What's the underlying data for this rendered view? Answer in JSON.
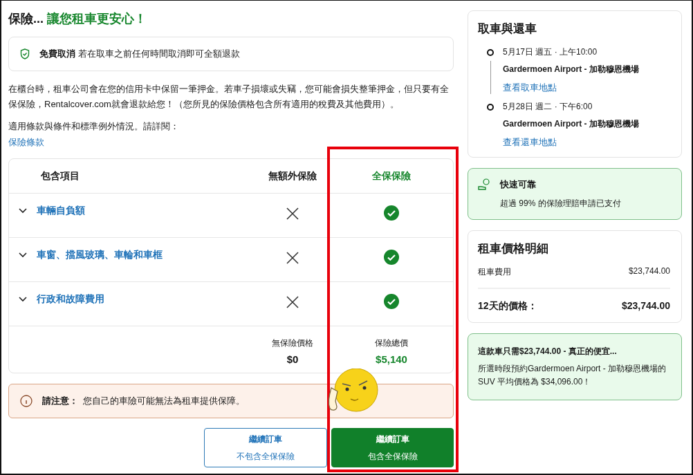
{
  "heading": {
    "prefix": "保險...",
    "highlight": "讓您租車更安心！"
  },
  "free_cancel": {
    "title": "免費取消",
    "text": "若在取車之前任何時間取消即可全額退款"
  },
  "intro": "在櫃台時，租車公司會在您的信用卡中保留一筆押金。若車子損壞或失竊，您可能會損失整筆押金，但只要有全保保險，Rentalcover.com就會退款給您！（您所見的保險價格包含所有適用的稅費及其他費用）。",
  "terms_note": "適用條款與條件和標準例外情況。請詳閱：",
  "terms_link": "保險條款",
  "table": {
    "columns": [
      "包含項目",
      "無額外保險",
      "全保保險"
    ],
    "rows": [
      {
        "label": "車輛自負額",
        "expanded": false,
        "basic_included": false,
        "full_included": true
      },
      {
        "label": "車窗、擋風玻璃、車輪和車框",
        "expanded": false,
        "basic_included": false,
        "full_included": true
      },
      {
        "label": "行政和故障費用",
        "expanded": false,
        "basic_included": false,
        "full_included": true
      }
    ],
    "totals": [
      {
        "label": "無保險價格",
        "value": "$0"
      },
      {
        "label": "保險總價",
        "value": "$5,140"
      }
    ],
    "highlight_full_column": true
  },
  "notice": {
    "title": "請注意：",
    "text": "您自己的車險可能無法為租車提供保障。"
  },
  "buttons": [
    {
      "kind": "outline",
      "title": "繼續訂車",
      "subtitle": "不包含全保保險"
    },
    {
      "kind": "primary",
      "title": "繼續訂車",
      "subtitle": "包含全保保險"
    }
  ],
  "trip": {
    "title": "取車與還車",
    "stops": [
      {
        "when": "5月17日 週五 · 上午10:00",
        "place": "Gardermoen Airport - 加勒穆恩機場",
        "link": "查看取車地點"
      },
      {
        "when": "5月28日 週二 · 下午6:00",
        "place": "Gardermoen Airport - 加勒穆恩機場",
        "link": "查看還車地點"
      }
    ]
  },
  "reliable": {
    "title": "快速可靠",
    "text": "超過 99% 的保險理賠申請已支付"
  },
  "price": {
    "title": "租車價格明細",
    "lines": [
      {
        "label": "租車費用",
        "value": "$23,744.00"
      }
    ],
    "total": {
      "label": "12天的價格：",
      "value": "$23,744.00"
    }
  },
  "deal": {
    "title": "這款車只需$23,744.00 - 真正的便宜...",
    "text": "所選時段預約Gardermoen Airport - 加勒穆恩機場的 SUV 平均價格為 $34,096.00！"
  }
}
